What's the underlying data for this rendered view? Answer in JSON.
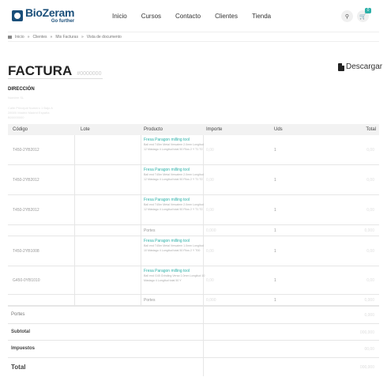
{
  "header": {
    "logo_name": "BioZeram",
    "logo_tagline": "Go further",
    "nav": [
      "Inicio",
      "Cursos",
      "Contacto",
      "Clientes",
      "Tienda"
    ],
    "cart_count": "0"
  },
  "breadcrumb": [
    "Inicio",
    "»",
    "Clientes",
    "»",
    "Mis Facturas",
    "»",
    "Vista de documento"
  ],
  "invoice": {
    "title": "FACTURA",
    "number": "#0000000",
    "download_label": "Descargar"
  },
  "address": {
    "label": "DIRECCIÓN",
    "lines": [
      "Nombre SL",
      "Calle Principal Numero 1 Bajo A",
      "28000 Madrid Madrid España",
      "B00000000"
    ]
  },
  "table": {
    "headers": [
      "Código",
      "Lote",
      "Producto",
      "Importe",
      "Uds",
      "Total"
    ],
    "rows": [
      {
        "code": "T450-2YB2012",
        "product_title": "Fresa Paragon milling tool",
        "product_desc": "Ball end T45m Metal Versatem 2.0mm Longitud 12 Mástago 4 Longitud total 50 Filos 2 Y T1 T2",
        "price": "0,00",
        "qty": "1",
        "total": "0,00"
      },
      {
        "code": "T450-2YB2012",
        "product_title": "Fresa Paragon milling tool",
        "product_desc": "Ball end T45m Metal Versatem 2.0mm Longitud 12 Mástago 4 Longitud total 50 Filos 2 Y T1 T2",
        "price": "0,00",
        "qty": "1",
        "total": "0,00"
      },
      {
        "code": "T450-2YB2012",
        "product_title": "Fresa Paragon milling tool",
        "product_desc": "Ball end T45m Metal Versatem 2.0mm Longitud 12 Mástago 4 Longitud total 50 Filos 2 Y T1 T2",
        "price": "0,00",
        "qty": "1",
        "total": "0,00"
      },
      {
        "code": "",
        "product_title": "Portes",
        "product_desc": "",
        "price": "0,000",
        "qty": "1",
        "total": "0,000"
      },
      {
        "code": "T450-2YB1008",
        "product_title": "Fresa Paragon milling tool",
        "product_desc": "Ball end T45m Metal Versatem 1.0mm Longitud 10 Mástago 4 Longitud total 50 Filos 2 Y T00",
        "price": "0,00",
        "qty": "1",
        "total": "0,00"
      },
      {
        "code": "G450-0YB1010",
        "product_title": "Fresa Paragon milling tool",
        "product_desc": "Ball end G45 Grinding Versa 1.0mm Longitud 10 Mástago 4 Longitud total 50 Y",
        "price": "0,00",
        "qty": "1",
        "total": "0,00"
      },
      {
        "code": "",
        "product_title": "Portes",
        "product_desc": "",
        "price": "0,000",
        "qty": "1",
        "total": "0,000"
      }
    ]
  },
  "totals": [
    {
      "label": "Portes",
      "value": "0,000"
    },
    {
      "label": "Subtotal",
      "value": "000,000"
    },
    {
      "label": "Impuestos",
      "value": "00,00"
    },
    {
      "label": "Total",
      "value": "000,000"
    }
  ]
}
